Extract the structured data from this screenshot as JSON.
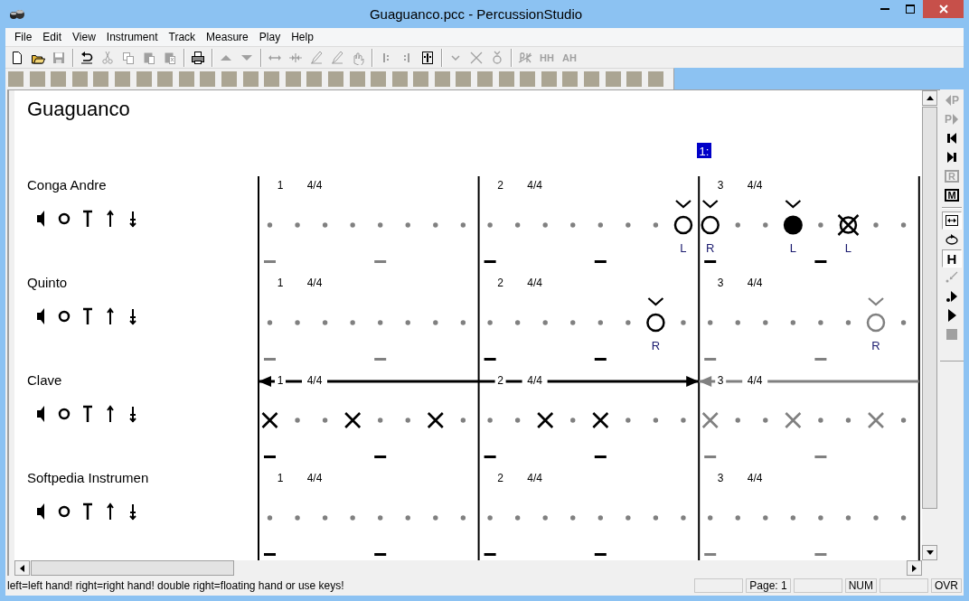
{
  "window": {
    "title": "Guaguanco.pcc - PercussionStudio"
  },
  "menu": [
    "File",
    "Edit",
    "View",
    "Instrument",
    "Track",
    "Measure",
    "Play",
    "Help"
  ],
  "toolbar": [
    {
      "kind": "new",
      "disabled": false
    },
    {
      "kind": "open",
      "disabled": false
    },
    {
      "kind": "save",
      "disabled": true
    },
    {
      "kind": "separator"
    },
    {
      "kind": "undo",
      "disabled": false
    },
    {
      "kind": "cut",
      "disabled": true
    },
    {
      "kind": "copy",
      "disabled": true
    },
    {
      "kind": "paste",
      "disabled": true
    },
    {
      "kind": "paste-special",
      "disabled": true
    },
    {
      "kind": "separator"
    },
    {
      "kind": "print",
      "disabled": false
    },
    {
      "kind": "separator"
    },
    {
      "kind": "up",
      "disabled": true
    },
    {
      "kind": "down",
      "disabled": true
    },
    {
      "kind": "separator"
    },
    {
      "kind": "stretch",
      "disabled": true
    },
    {
      "kind": "shrink",
      "disabled": true
    },
    {
      "kind": "pencil",
      "disabled": true
    },
    {
      "kind": "pencil",
      "disabled": true
    },
    {
      "kind": "hand",
      "disabled": true
    },
    {
      "kind": "separator"
    },
    {
      "kind": "bar-left",
      "disabled": true
    },
    {
      "kind": "bar-right",
      "disabled": true
    },
    {
      "kind": "bar-both",
      "disabled": false
    },
    {
      "kind": "separator"
    },
    {
      "kind": "accent",
      "disabled": true
    },
    {
      "kind": "cross",
      "disabled": true
    },
    {
      "kind": "accent-ring",
      "disabled": true
    },
    {
      "kind": "separator"
    },
    {
      "kind": "strike",
      "disabled": true
    },
    {
      "kind": "text",
      "label": "HH",
      "disabled": true
    },
    {
      "kind": "text",
      "label": "AH",
      "disabled": true
    }
  ],
  "score": {
    "title": "Guaguanco",
    "cursor_label": "1:",
    "tracks": [
      {
        "name": "Conga Andre",
        "measures": [
          {
            "number": "1",
            "time": "4/4",
            "active": false,
            "beats": [
              {
                "kind": "dot"
              },
              {
                "kind": "dot"
              },
              {
                "kind": "dot"
              },
              {
                "kind": "dot"
              },
              {
                "kind": "dot"
              },
              {
                "kind": "dot"
              },
              {
                "kind": "dot"
              },
              {
                "kind": "dot"
              }
            ]
          },
          {
            "number": "2",
            "time": "4/4",
            "active": true,
            "beats": [
              {
                "kind": "dot"
              },
              {
                "kind": "dot"
              },
              {
                "kind": "dot"
              },
              {
                "kind": "dot"
              },
              {
                "kind": "dot"
              },
              {
                "kind": "dot"
              },
              {
                "kind": "dot"
              },
              {
                "kind": "open",
                "accent": true,
                "hand": "L"
              }
            ]
          },
          {
            "number": "3",
            "time": "4/4",
            "active": true,
            "beats": [
              {
                "kind": "open",
                "accent": true,
                "hand": "R"
              },
              {
                "kind": "dot"
              },
              {
                "kind": "dot"
              },
              {
                "kind": "slap",
                "accent": true,
                "hand": "L"
              },
              {
                "kind": "dot"
              },
              {
                "kind": "muted",
                "accent": false,
                "hand": "L"
              },
              {
                "kind": "dot"
              },
              {
                "kind": "dot"
              }
            ]
          }
        ]
      },
      {
        "name": "Quinto",
        "measures": [
          {
            "number": "1",
            "time": "4/4",
            "active": false,
            "beats": [
              {
                "kind": "dot"
              },
              {
                "kind": "dot"
              },
              {
                "kind": "dot"
              },
              {
                "kind": "dot"
              },
              {
                "kind": "dot"
              },
              {
                "kind": "dot"
              },
              {
                "kind": "dot"
              },
              {
                "kind": "dot"
              }
            ]
          },
          {
            "number": "2",
            "time": "4/4",
            "active": true,
            "beats": [
              {
                "kind": "dot"
              },
              {
                "kind": "dot"
              },
              {
                "kind": "dot"
              },
              {
                "kind": "dot"
              },
              {
                "kind": "dot"
              },
              {
                "kind": "dot"
              },
              {
                "kind": "open",
                "accent": true,
                "hand": "R"
              },
              {
                "kind": "dot"
              }
            ]
          },
          {
            "number": "3",
            "time": "4/4",
            "active": false,
            "beats": [
              {
                "kind": "dot"
              },
              {
                "kind": "dot"
              },
              {
                "kind": "dot"
              },
              {
                "kind": "dot"
              },
              {
                "kind": "dot"
              },
              {
                "kind": "dot"
              },
              {
                "kind": "open",
                "accent": true,
                "hand": "R"
              },
              {
                "kind": "dot"
              }
            ]
          }
        ]
      },
      {
        "name": "Clave",
        "measures": [
          {
            "number": "1",
            "time": "4/4",
            "active": true,
            "range_line": true,
            "beats": [
              {
                "kind": "x",
                "accent": false
              },
              {
                "kind": "dot"
              },
              {
                "kind": "dot"
              },
              {
                "kind": "x",
                "accent": false
              },
              {
                "kind": "dot"
              },
              {
                "kind": "dot"
              },
              {
                "kind": "x",
                "accent": false
              },
              {
                "kind": "dot"
              }
            ]
          },
          {
            "number": "2",
            "time": "4/4",
            "active": true,
            "range_line": true,
            "beats": [
              {
                "kind": "dot"
              },
              {
                "kind": "dot"
              },
              {
                "kind": "x",
                "accent": false
              },
              {
                "kind": "dot"
              },
              {
                "kind": "x",
                "accent": false
              },
              {
                "kind": "dot"
              },
              {
                "kind": "dot"
              },
              {
                "kind": "dot"
              }
            ]
          },
          {
            "number": "3",
            "time": "4/4",
            "active": false,
            "range_line": true,
            "beats": [
              {
                "kind": "x",
                "accent": false
              },
              {
                "kind": "dot"
              },
              {
                "kind": "dot"
              },
              {
                "kind": "x",
                "accent": false
              },
              {
                "kind": "dot"
              },
              {
                "kind": "dot"
              },
              {
                "kind": "x",
                "accent": false
              },
              {
                "kind": "dot"
              }
            ]
          }
        ]
      },
      {
        "name": "Softpedia Instrumen",
        "measures": [
          {
            "number": "1",
            "time": "4/4",
            "active": true,
            "beats": [
              {
                "kind": "dot"
              },
              {
                "kind": "dot"
              },
              {
                "kind": "dot"
              },
              {
                "kind": "dot"
              },
              {
                "kind": "dot"
              },
              {
                "kind": "dot"
              },
              {
                "kind": "dot"
              },
              {
                "kind": "dot"
              }
            ]
          },
          {
            "number": "2",
            "time": "4/4",
            "active": true,
            "beats": [
              {
                "kind": "dot"
              },
              {
                "kind": "dot"
              },
              {
                "kind": "dot"
              },
              {
                "kind": "dot"
              },
              {
                "kind": "dot"
              },
              {
                "kind": "dot"
              },
              {
                "kind": "dot"
              },
              {
                "kind": "dot"
              }
            ]
          },
          {
            "number": "3",
            "time": "4/4",
            "active": false,
            "beats": [
              {
                "kind": "dot"
              },
              {
                "kind": "dot"
              },
              {
                "kind": "dot"
              },
              {
                "kind": "dot"
              },
              {
                "kind": "dot"
              },
              {
                "kind": "dot"
              },
              {
                "kind": "dot"
              },
              {
                "kind": "dot"
              }
            ]
          }
        ]
      }
    ]
  },
  "side_toolbar": [
    {
      "kind": "prev-page",
      "label": "P",
      "disabled": true,
      "pressed": false
    },
    {
      "kind": "next-page",
      "label": "P",
      "disabled": true,
      "pressed": false
    },
    {
      "kind": "first",
      "disabled": false,
      "pressed": false
    },
    {
      "kind": "last",
      "disabled": false,
      "pressed": false
    },
    {
      "kind": "boxed",
      "label": "R",
      "disabled": true,
      "pressed": false
    },
    {
      "kind": "boxed",
      "label": "M",
      "disabled": false,
      "pressed": false
    },
    {
      "kind": "separator"
    },
    {
      "kind": "fit",
      "disabled": false,
      "pressed": true
    },
    {
      "kind": "loop",
      "disabled": false,
      "pressed": false
    },
    {
      "kind": "letter",
      "label": "H",
      "disabled": false,
      "pressed": true
    },
    {
      "kind": "pen",
      "disabled": true,
      "pressed": false
    },
    {
      "kind": "step",
      "disabled": false,
      "pressed": false
    },
    {
      "kind": "play",
      "disabled": false,
      "pressed": false
    },
    {
      "kind": "stop",
      "disabled": true,
      "pressed": false
    }
  ],
  "status_bar": {
    "message": "left=left hand! right=right hand! double right=floating hand or use keys!",
    "panels": [
      {
        "kind": "blank"
      },
      {
        "kind": "text",
        "text": "Page: 1"
      },
      {
        "kind": "blank"
      },
      {
        "kind": "text",
        "text": "NUM"
      },
      {
        "kind": "blank"
      },
      {
        "kind": "text",
        "text": "OVR"
      }
    ]
  }
}
